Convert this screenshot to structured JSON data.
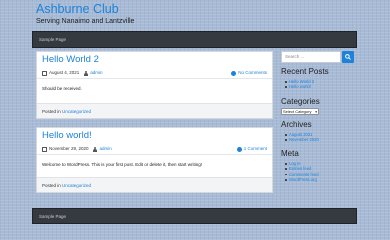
{
  "site": {
    "title": "Ashburne Club",
    "description": "Serving Nanaimo and Lantzville"
  },
  "nav": {
    "top_link": "Sample Page",
    "bottom_link": "Sample Page"
  },
  "posts": [
    {
      "title": "Hello World 2",
      "date": "August 4, 2021",
      "author": "admin",
      "comments": "No Comments",
      "body": "Should be received.",
      "footer_prefix": "Posted in",
      "category": "Uncategorized"
    },
    {
      "title": "Hello world!",
      "date": "November 29, 2020",
      "author": "admin",
      "comments": "1 Comment",
      "body": "Welcome to WordPress. This is your first post. Edit or delete it, then start writing!",
      "footer_prefix": "Posted in",
      "category": "Uncategorized"
    }
  ],
  "sidebar": {
    "search_placeholder": "Search ...",
    "recent_posts_title": "Recent Posts",
    "recent_posts": [
      "Hello World 2",
      "Hello world!"
    ],
    "categories_title": "Categories",
    "category_select": "Select Category",
    "archives_title": "Archives",
    "archives": [
      "August 2021",
      "November 2020"
    ],
    "meta_title": "Meta",
    "meta_links": [
      "Log in",
      "Entries feed",
      "Comments feed",
      "WordPress.org"
    ]
  },
  "colors": {
    "link": "#1d82d8",
    "navbar": "#353a40",
    "background": "#a7bad6"
  }
}
